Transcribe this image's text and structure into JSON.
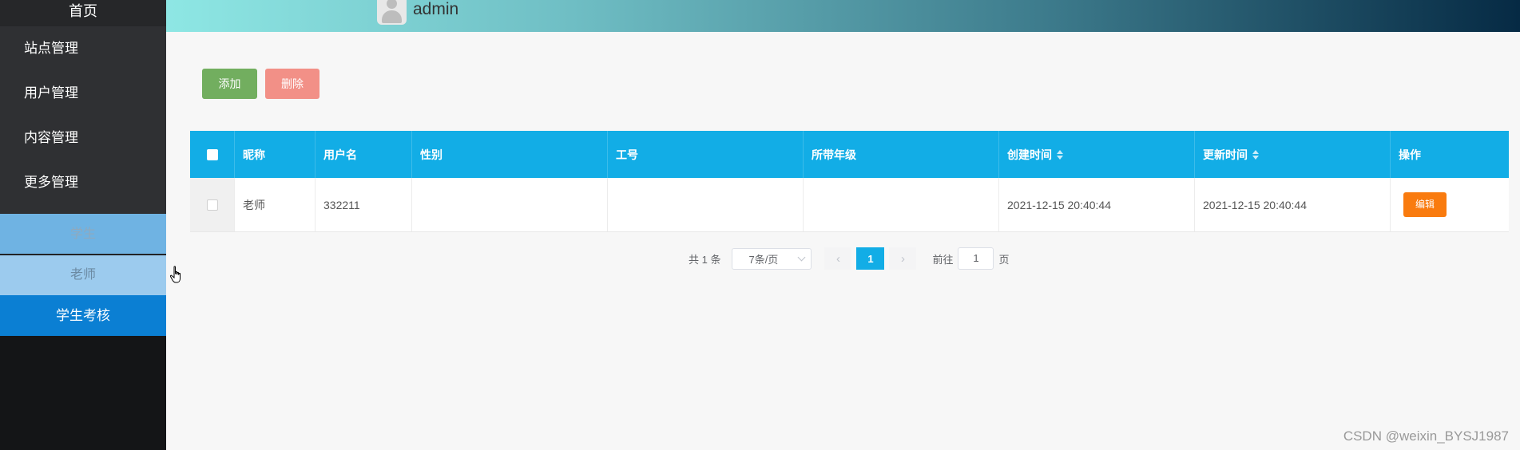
{
  "sidebar": {
    "home": "首页",
    "items": [
      {
        "label": "站点管理"
      },
      {
        "label": "用户管理"
      },
      {
        "label": "内容管理"
      },
      {
        "label": "更多管理"
      }
    ],
    "subitems": [
      {
        "label": "学生"
      },
      {
        "label": "老师"
      },
      {
        "label": "学生考核"
      }
    ]
  },
  "header": {
    "username": "admin",
    "avatar_icon": "user-avatar-icon"
  },
  "toolbar": {
    "add_label": "添加",
    "delete_label": "删除"
  },
  "table": {
    "columns": [
      "昵称",
      "用户名",
      "性别",
      "工号",
      "所带年级",
      "创建时间",
      "更新时间",
      "操作"
    ],
    "rows": [
      {
        "nickname": "老师",
        "username": "332211",
        "gender": "",
        "job_no": "",
        "grade": "",
        "created": "2021-12-15 20:40:44",
        "updated": "2021-12-15 20:40:44",
        "action_label": "编辑"
      }
    ],
    "header_color": "#12ade6"
  },
  "pagination": {
    "total_text": "共 1 条",
    "page_size": "7条/页",
    "current_page": "1",
    "goto_label": "前往",
    "goto_value": "1",
    "page_suffix": "页"
  },
  "watermark": "CSDN @weixin_BYSJ1987",
  "colors": {
    "add_button": "#72ae5f",
    "delete_button": "#f29087",
    "edit_button": "#f97b0f",
    "active_menu": "#0b7fd3"
  }
}
